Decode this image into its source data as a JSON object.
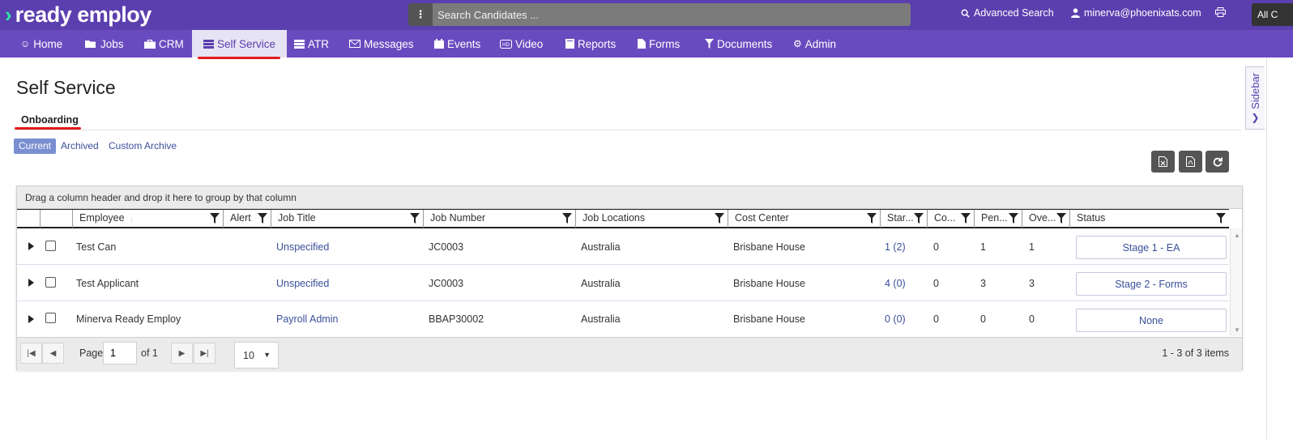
{
  "app": {
    "logo_text": "ready employ"
  },
  "search": {
    "placeholder": "Search Candidates ..."
  },
  "topbar": {
    "advanced_search": "Advanced Search",
    "user_email": "minerva@phoenixats.com",
    "all_label": "All C"
  },
  "nav": {
    "items": [
      {
        "label": "Home",
        "icon": "home-icon"
      },
      {
        "label": "Jobs",
        "icon": "folder-icon"
      },
      {
        "label": "CRM",
        "icon": "briefcase-icon"
      },
      {
        "label": "Self Service",
        "icon": "list-icon",
        "active": true
      },
      {
        "label": "ATR",
        "icon": "list-icon"
      },
      {
        "label": "Messages",
        "icon": "envelope-icon"
      },
      {
        "label": "Events",
        "icon": "calendar-icon"
      },
      {
        "label": "Video",
        "icon": "video-icon"
      },
      {
        "label": "Reports",
        "icon": "book-icon"
      },
      {
        "label": "Forms",
        "icon": "file-icon"
      },
      {
        "label": "Documents",
        "icon": "filter-icon"
      },
      {
        "label": "Admin",
        "icon": "gear-icon"
      }
    ]
  },
  "sidebar_tab": {
    "label": "Sidebar"
  },
  "page": {
    "title": "Self Service",
    "tab": "Onboarding",
    "filters": [
      "Current",
      "Archived",
      "Custom Archive"
    ]
  },
  "grid": {
    "group_hint": "Drag a column header and drop it here to group by that column",
    "columns": [
      "Employee",
      "Alert",
      "Job Title",
      "Job Number",
      "Job Locations",
      "Cost Center",
      "Star...",
      "Co...",
      "Pen...",
      "Ove...",
      "Status"
    ],
    "rows": [
      {
        "employee": "Test Can",
        "job_title": "Unspecified",
        "job_number": "JC0003",
        "location": "Australia",
        "cost_center": "Brisbane House",
        "started": "1 (2)",
        "completed": "0",
        "pending": "1",
        "overdue": "1",
        "status": "Stage 1 - EA"
      },
      {
        "employee": "Test Applicant",
        "job_title": "Unspecified",
        "job_number": "JC0003",
        "location": "Australia",
        "cost_center": "Brisbane House",
        "started": "4 (0)",
        "completed": "0",
        "pending": "3",
        "overdue": "3",
        "status": "Stage 2 - Forms"
      },
      {
        "employee": "Minerva Ready Employ",
        "job_title": "Payroll Admin",
        "job_number": "BBAP30002",
        "location": "Australia",
        "cost_center": "Brisbane House",
        "started": "0 (0)",
        "completed": "0",
        "pending": "0",
        "overdue": "0",
        "status": "None"
      }
    ],
    "pager": {
      "page_label": "Page",
      "page_value": "1",
      "of_label": "of 1",
      "page_size": "10",
      "info": "1 - 3 of 3 items"
    }
  },
  "colors": {
    "header_purple": "#5b3fae",
    "nav_purple": "#6a4bbf",
    "accent_green": "#2ee6a6",
    "link_blue": "#3a4f9a",
    "annotation_red": "#e31b1b"
  }
}
